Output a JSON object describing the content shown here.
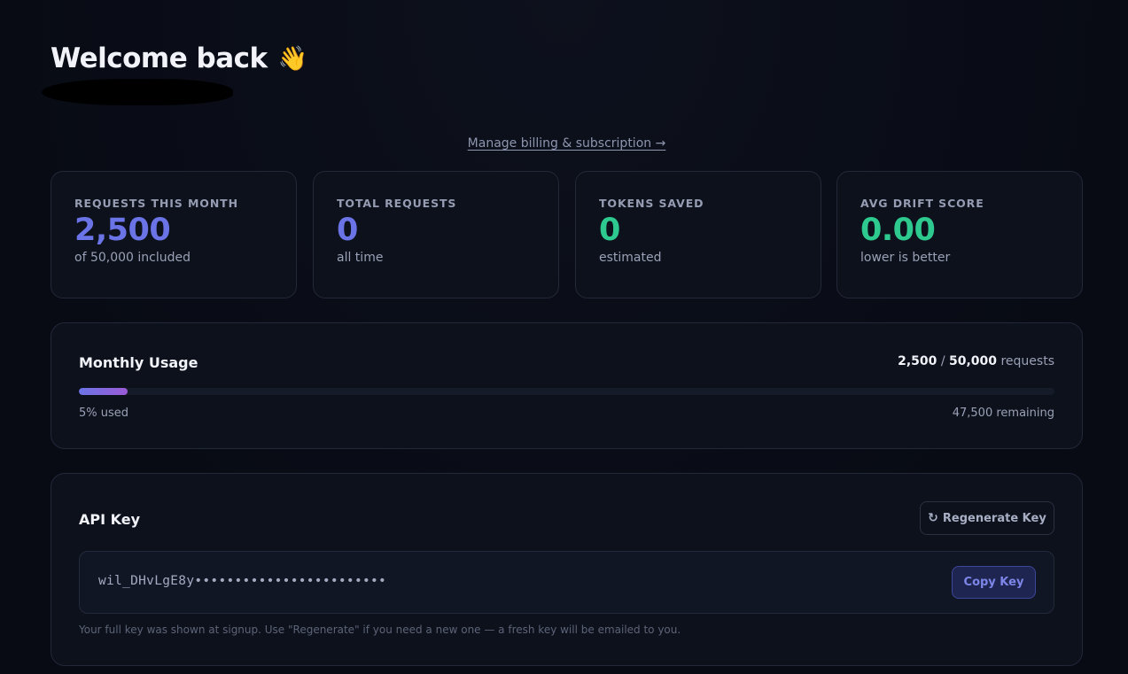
{
  "header": {
    "welcome": "Welcome back",
    "wave_icon": "👋",
    "billing_link": "Manage billing & subscription →"
  },
  "stats": [
    {
      "label": "REQUESTS THIS MONTH",
      "value": "2,500",
      "sub": "of 50,000 included",
      "color": "#6b74e6"
    },
    {
      "label": "TOTAL REQUESTS",
      "value": "0",
      "sub": "all time",
      "color": "#6b74e6"
    },
    {
      "label": "TOKENS SAVED",
      "value": "0",
      "sub": "estimated",
      "color": "#2dc98f"
    },
    {
      "label": "AVG DRIFT SCORE",
      "value": "0.00",
      "sub": "lower is better",
      "color": "#2dc98f"
    }
  ],
  "usage": {
    "title": "Monthly Usage",
    "used": "2,500",
    "separator": "/",
    "total": "50,000",
    "unit": "requests",
    "percent_used": 5,
    "used_text": "5% used",
    "remaining_text": "47,500 remaining"
  },
  "api_key": {
    "title": "API Key",
    "regenerate_icon": "↻",
    "regenerate_label": "Regenerate Key",
    "key_display": "wil_DHvLgE8y••••••••••••••••••••••••",
    "copy_label": "Copy Key",
    "note": "Your full key was shown at signup. Use \"Regenerate\" if you need a new one — a fresh key will be emailed to you."
  }
}
